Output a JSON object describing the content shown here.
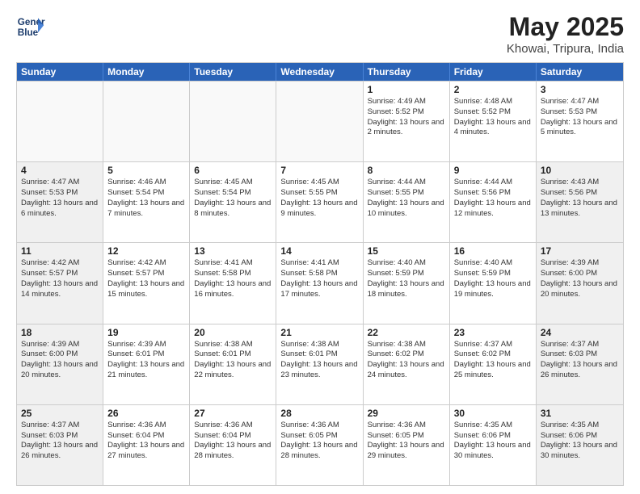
{
  "header": {
    "logo_line1": "General",
    "logo_line2": "Blue",
    "month": "May 2025",
    "location": "Khowai, Tripura, India"
  },
  "days": [
    "Sunday",
    "Monday",
    "Tuesday",
    "Wednesday",
    "Thursday",
    "Friday",
    "Saturday"
  ],
  "weeks": [
    [
      {
        "date": "",
        "info": "",
        "empty": true
      },
      {
        "date": "",
        "info": "",
        "empty": true
      },
      {
        "date": "",
        "info": "",
        "empty": true
      },
      {
        "date": "",
        "info": "",
        "empty": true
      },
      {
        "date": "1",
        "info": "Sunrise: 4:49 AM\nSunset: 5:52 PM\nDaylight: 13 hours\nand 2 minutes.",
        "empty": false
      },
      {
        "date": "2",
        "info": "Sunrise: 4:48 AM\nSunset: 5:52 PM\nDaylight: 13 hours\nand 4 minutes.",
        "empty": false
      },
      {
        "date": "3",
        "info": "Sunrise: 4:47 AM\nSunset: 5:53 PM\nDaylight: 13 hours\nand 5 minutes.",
        "empty": false
      }
    ],
    [
      {
        "date": "4",
        "info": "Sunrise: 4:47 AM\nSunset: 5:53 PM\nDaylight: 13 hours\nand 6 minutes.",
        "empty": false,
        "shaded": true
      },
      {
        "date": "5",
        "info": "Sunrise: 4:46 AM\nSunset: 5:54 PM\nDaylight: 13 hours\nand 7 minutes.",
        "empty": false
      },
      {
        "date": "6",
        "info": "Sunrise: 4:45 AM\nSunset: 5:54 PM\nDaylight: 13 hours\nand 8 minutes.",
        "empty": false
      },
      {
        "date": "7",
        "info": "Sunrise: 4:45 AM\nSunset: 5:55 PM\nDaylight: 13 hours\nand 9 minutes.",
        "empty": false
      },
      {
        "date": "8",
        "info": "Sunrise: 4:44 AM\nSunset: 5:55 PM\nDaylight: 13 hours\nand 10 minutes.",
        "empty": false
      },
      {
        "date": "9",
        "info": "Sunrise: 4:44 AM\nSunset: 5:56 PM\nDaylight: 13 hours\nand 12 minutes.",
        "empty": false
      },
      {
        "date": "10",
        "info": "Sunrise: 4:43 AM\nSunset: 5:56 PM\nDaylight: 13 hours\nand 13 minutes.",
        "empty": false,
        "shaded": true
      }
    ],
    [
      {
        "date": "11",
        "info": "Sunrise: 4:42 AM\nSunset: 5:57 PM\nDaylight: 13 hours\nand 14 minutes.",
        "empty": false,
        "shaded": true
      },
      {
        "date": "12",
        "info": "Sunrise: 4:42 AM\nSunset: 5:57 PM\nDaylight: 13 hours\nand 15 minutes.",
        "empty": false
      },
      {
        "date": "13",
        "info": "Sunrise: 4:41 AM\nSunset: 5:58 PM\nDaylight: 13 hours\nand 16 minutes.",
        "empty": false
      },
      {
        "date": "14",
        "info": "Sunrise: 4:41 AM\nSunset: 5:58 PM\nDaylight: 13 hours\nand 17 minutes.",
        "empty": false
      },
      {
        "date": "15",
        "info": "Sunrise: 4:40 AM\nSunset: 5:59 PM\nDaylight: 13 hours\nand 18 minutes.",
        "empty": false
      },
      {
        "date": "16",
        "info": "Sunrise: 4:40 AM\nSunset: 5:59 PM\nDaylight: 13 hours\nand 19 minutes.",
        "empty": false
      },
      {
        "date": "17",
        "info": "Sunrise: 4:39 AM\nSunset: 6:00 PM\nDaylight: 13 hours\nand 20 minutes.",
        "empty": false,
        "shaded": true
      }
    ],
    [
      {
        "date": "18",
        "info": "Sunrise: 4:39 AM\nSunset: 6:00 PM\nDaylight: 13 hours\nand 20 minutes.",
        "empty": false,
        "shaded": true
      },
      {
        "date": "19",
        "info": "Sunrise: 4:39 AM\nSunset: 6:01 PM\nDaylight: 13 hours\nand 21 minutes.",
        "empty": false
      },
      {
        "date": "20",
        "info": "Sunrise: 4:38 AM\nSunset: 6:01 PM\nDaylight: 13 hours\nand 22 minutes.",
        "empty": false
      },
      {
        "date": "21",
        "info": "Sunrise: 4:38 AM\nSunset: 6:01 PM\nDaylight: 13 hours\nand 23 minutes.",
        "empty": false
      },
      {
        "date": "22",
        "info": "Sunrise: 4:38 AM\nSunset: 6:02 PM\nDaylight: 13 hours\nand 24 minutes.",
        "empty": false
      },
      {
        "date": "23",
        "info": "Sunrise: 4:37 AM\nSunset: 6:02 PM\nDaylight: 13 hours\nand 25 minutes.",
        "empty": false
      },
      {
        "date": "24",
        "info": "Sunrise: 4:37 AM\nSunset: 6:03 PM\nDaylight: 13 hours\nand 26 minutes.",
        "empty": false,
        "shaded": true
      }
    ],
    [
      {
        "date": "25",
        "info": "Sunrise: 4:37 AM\nSunset: 6:03 PM\nDaylight: 13 hours\nand 26 minutes.",
        "empty": false,
        "shaded": true
      },
      {
        "date": "26",
        "info": "Sunrise: 4:36 AM\nSunset: 6:04 PM\nDaylight: 13 hours\nand 27 minutes.",
        "empty": false
      },
      {
        "date": "27",
        "info": "Sunrise: 4:36 AM\nSunset: 6:04 PM\nDaylight: 13 hours\nand 28 minutes.",
        "empty": false
      },
      {
        "date": "28",
        "info": "Sunrise: 4:36 AM\nSunset: 6:05 PM\nDaylight: 13 hours\nand 28 minutes.",
        "empty": false
      },
      {
        "date": "29",
        "info": "Sunrise: 4:36 AM\nSunset: 6:05 PM\nDaylight: 13 hours\nand 29 minutes.",
        "empty": false
      },
      {
        "date": "30",
        "info": "Sunrise: 4:35 AM\nSunset: 6:06 PM\nDaylight: 13 hours\nand 30 minutes.",
        "empty": false
      },
      {
        "date": "31",
        "info": "Sunrise: 4:35 AM\nSunset: 6:06 PM\nDaylight: 13 hours\nand 30 minutes.",
        "empty": false,
        "shaded": true
      }
    ]
  ]
}
